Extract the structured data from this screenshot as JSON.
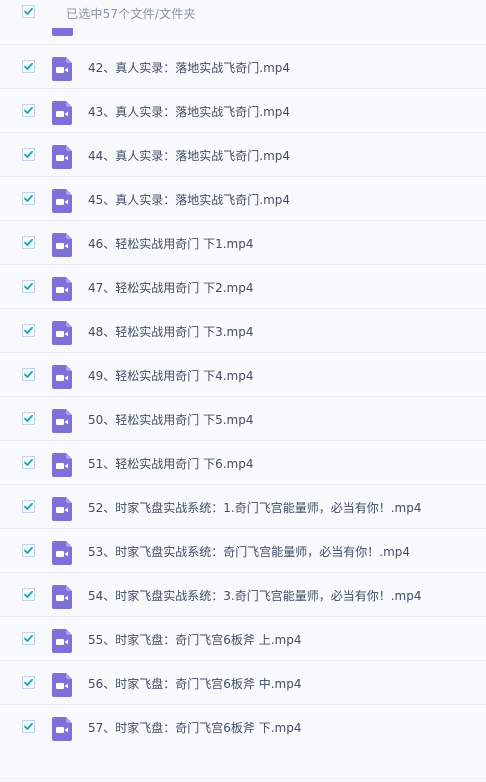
{
  "header": {
    "selected_text": "已选中57个文件/文件夹"
  },
  "colors": {
    "check": "#18a7a0",
    "video_icon": "#7d72d8",
    "text": "#424e67",
    "muted": "#8a94a6"
  },
  "icons": {
    "checkbox": "check-icon",
    "file": "video-file-icon"
  },
  "files": [
    {
      "name": "42、真人实录：落地实战飞奇门.mp4"
    },
    {
      "name": "43、真人实录：落地实战飞奇门.mp4"
    },
    {
      "name": "44、真人实录：落地实战飞奇门.mp4"
    },
    {
      "name": "45、真人实录：落地实战飞奇门.mp4"
    },
    {
      "name": "46、轻松实战用奇门 下1.mp4"
    },
    {
      "name": "47、轻松实战用奇门 下2.mp4"
    },
    {
      "name": "48、轻松实战用奇门 下3.mp4"
    },
    {
      "name": "49、轻松实战用奇门 下4.mp4"
    },
    {
      "name": "50、轻松实战用奇门 下5.mp4"
    },
    {
      "name": "51、轻松实战用奇门 下6.mp4"
    },
    {
      "name": "52、时家飞盘实战系统：1.奇门飞宫能量师，必当有你！.mp4"
    },
    {
      "name": "53、时家飞盘实战系统：奇门飞宫能量师，必当有你！.mp4"
    },
    {
      "name": "54、时家飞盘实战系统：3.奇门飞宫能量师，必当有你！.mp4"
    },
    {
      "name": "55、时家飞盘：奇门飞宫6板斧 上.mp4"
    },
    {
      "name": "56、时家飞盘：奇门飞宫6板斧 中.mp4"
    },
    {
      "name": "57、时家飞盘：奇门飞宫6板斧 下.mp4"
    }
  ]
}
